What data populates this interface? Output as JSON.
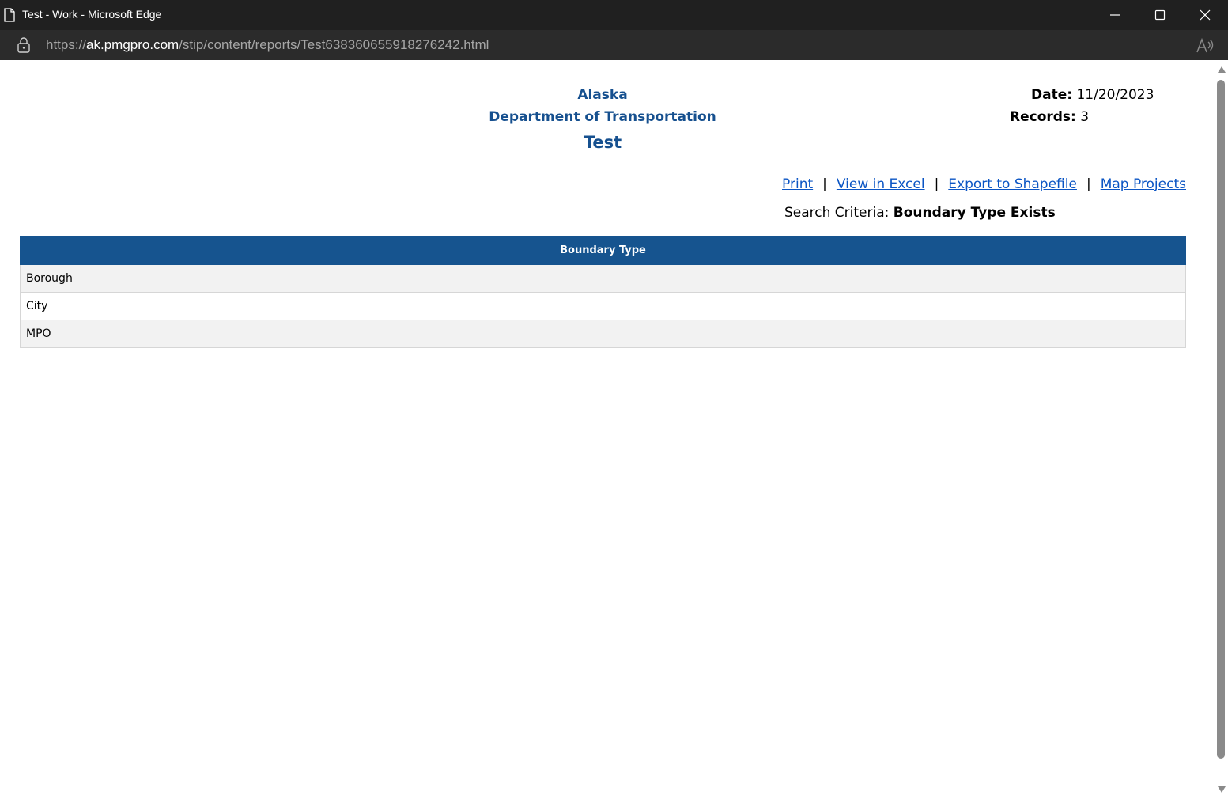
{
  "window": {
    "title": "Test - Work - Microsoft Edge",
    "controls": [
      "minimize-icon",
      "maximize-icon",
      "close-icon"
    ]
  },
  "address_bar": {
    "url_prefix": "https://",
    "url_host": "ak.pmgpro.com",
    "url_path": "/stip/content/reports/Test638360655918276242.html"
  },
  "report": {
    "org_name": "Alaska",
    "org_dept": "Department of Transportation",
    "title": "Test",
    "date_label": "Date:",
    "date_value": "11/20/2023",
    "records_label": "Records:",
    "records_value": "3"
  },
  "actions": {
    "print": "Print",
    "excel": "View in Excel",
    "shapefile": "Export to Shapefile",
    "map": "Map Projects",
    "separator": "|"
  },
  "criteria": {
    "label": "Search Criteria:",
    "value": "Boundary Type Exists"
  },
  "table": {
    "header": "Boundary Type",
    "rows": [
      "Borough",
      "City",
      "MPO"
    ]
  },
  "colors": {
    "header_bg": "#16548f",
    "title_blue": "#16508f",
    "link": "#0b55c4"
  }
}
